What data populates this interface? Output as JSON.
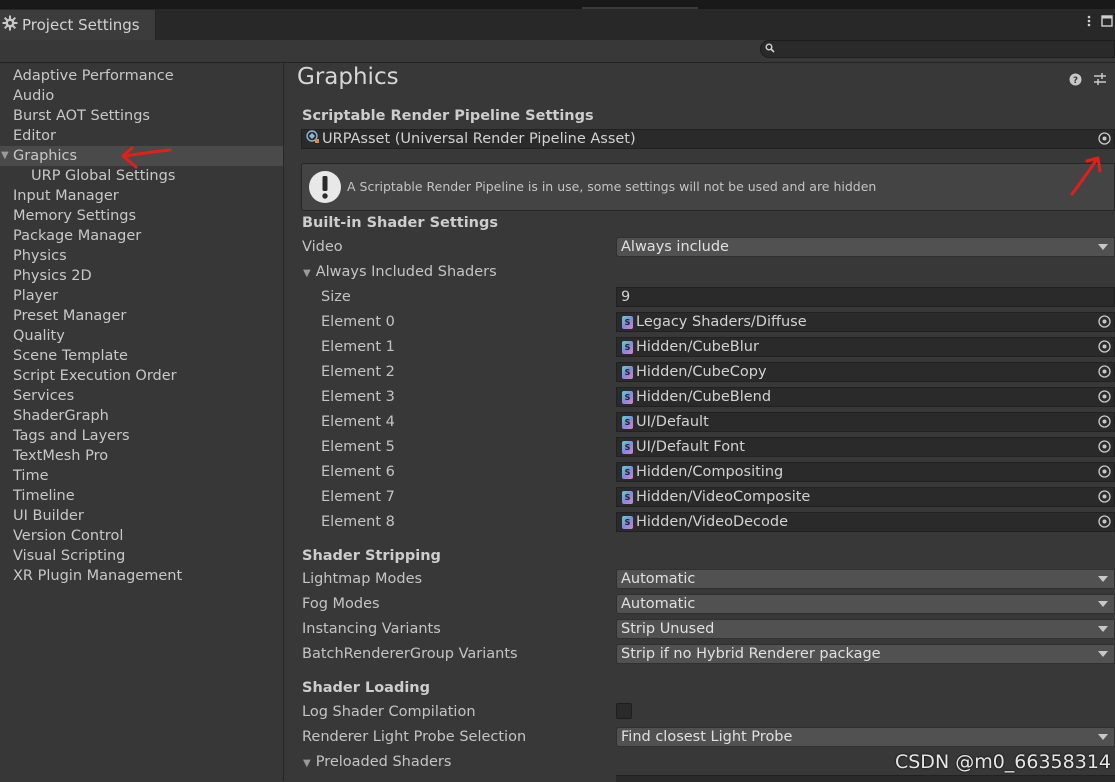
{
  "window": {
    "tab_title": "Project Settings"
  },
  "search": {
    "placeholder": ""
  },
  "sidebar": {
    "items": [
      {
        "label": "Adaptive Performance"
      },
      {
        "label": "Audio"
      },
      {
        "label": "Burst AOT Settings"
      },
      {
        "label": "Editor"
      },
      {
        "label": "Graphics",
        "selected": true
      },
      {
        "label": "URP Global Settings",
        "child": true
      },
      {
        "label": "Input Manager"
      },
      {
        "label": "Memory Settings"
      },
      {
        "label": "Package Manager"
      },
      {
        "label": "Physics"
      },
      {
        "label": "Physics 2D"
      },
      {
        "label": "Player"
      },
      {
        "label": "Preset Manager"
      },
      {
        "label": "Quality"
      },
      {
        "label": "Scene Template"
      },
      {
        "label": "Script Execution Order"
      },
      {
        "label": "Services"
      },
      {
        "label": "ShaderGraph"
      },
      {
        "label": "Tags and Layers"
      },
      {
        "label": "TextMesh Pro"
      },
      {
        "label": "Time"
      },
      {
        "label": "Timeline"
      },
      {
        "label": "UI Builder"
      },
      {
        "label": "Version Control"
      },
      {
        "label": "Visual Scripting"
      },
      {
        "label": "XR Plugin Management"
      }
    ]
  },
  "page": {
    "title": "Graphics",
    "srp": {
      "heading": "Scriptable Render Pipeline Settings",
      "asset": "URPAsset (Universal Render Pipeline Asset)",
      "help": "A Scriptable Render Pipeline is in use, some settings will not be used and are hidden"
    },
    "builtin": {
      "heading": "Built-in Shader Settings",
      "video_label": "Video",
      "video_value": "Always include",
      "always_included_label": "Always Included Shaders",
      "size_label": "Size",
      "size_value": "9",
      "elements": [
        {
          "label": "Element 0",
          "value": "Legacy Shaders/Diffuse"
        },
        {
          "label": "Element 1",
          "value": "Hidden/CubeBlur"
        },
        {
          "label": "Element 2",
          "value": "Hidden/CubeCopy"
        },
        {
          "label": "Element 3",
          "value": "Hidden/CubeBlend"
        },
        {
          "label": "Element 4",
          "value": "UI/Default"
        },
        {
          "label": "Element 5",
          "value": "UI/Default Font"
        },
        {
          "label": "Element 6",
          "value": "Hidden/Compositing"
        },
        {
          "label": "Element 7",
          "value": "Hidden/VideoComposite"
        },
        {
          "label": "Element 8",
          "value": "Hidden/VideoDecode"
        }
      ]
    },
    "stripping": {
      "heading": "Shader Stripping",
      "rows": [
        {
          "label": "Lightmap Modes",
          "value": "Automatic"
        },
        {
          "label": "Fog Modes",
          "value": "Automatic"
        },
        {
          "label": "Instancing Variants",
          "value": "Strip Unused"
        },
        {
          "label": "BatchRendererGroup Variants",
          "value": "Strip if no Hybrid Renderer package"
        }
      ]
    },
    "loading": {
      "heading": "Shader Loading",
      "log_label": "Log Shader Compilation",
      "log_checked": false,
      "probe_label": "Renderer Light Probe Selection",
      "probe_value": "Find closest Light Probe",
      "preloaded_label": "Preloaded Shaders"
    }
  },
  "watermark": "CSDN @m0_66358314",
  "colors": {
    "annotation_red": "#e0201b"
  }
}
